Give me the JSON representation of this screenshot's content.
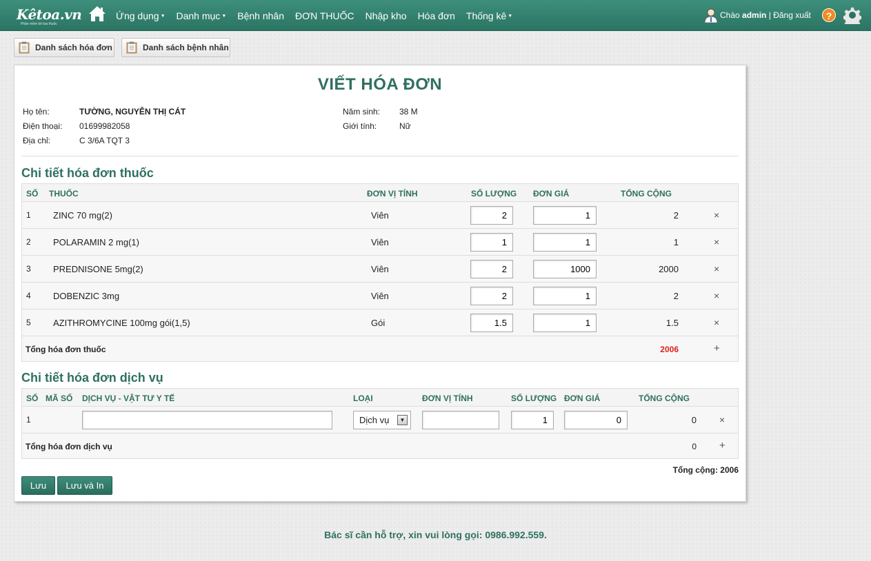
{
  "brand": {
    "logo": "Kêtoa.vn",
    "tagline": "Phần mềm kê toa thuốc"
  },
  "nav": {
    "home_icon": "home-icon",
    "items": [
      {
        "label": "Ứng dụng",
        "dropdown": true
      },
      {
        "label": "Danh mục",
        "dropdown": true
      },
      {
        "label": "Bệnh nhân",
        "dropdown": false
      },
      {
        "label": "ĐƠN THUỐC",
        "dropdown": false
      },
      {
        "label": "Nhập kho",
        "dropdown": false
      },
      {
        "label": "Hóa đơn",
        "dropdown": false
      },
      {
        "label": "Thống kê",
        "dropdown": true
      }
    ],
    "greeting": "Chào",
    "username": "admin",
    "separator": "|",
    "logout": "Đăng xuất"
  },
  "toolbar": {
    "invoice_list": "Danh sách hóa đơn",
    "patient_list": "Danh sách bệnh nhân"
  },
  "page_title": "VIẾT HÓA ĐƠN",
  "patient": {
    "name_label": "Họ tên:",
    "name": "TƯỜNG, NGUYỄN THỊ CÁT",
    "phone_label": "Điện thoại:",
    "phone": "01699982058",
    "address_label": "Địa chỉ:",
    "address": "C 3/6A TQT 3",
    "birth_label": "Năm sinh:",
    "birth": "38 M",
    "gender_label": "Giới tính:",
    "gender": "Nữ"
  },
  "drugs": {
    "section_title": "Chi tiết hóa đơn thuốc",
    "headers": {
      "no": "SỐ",
      "drug": "THUỐC",
      "unit": "ĐƠN VỊ TÍNH",
      "qty": "SỐ LƯỢNG",
      "price": "ĐƠN GIÁ",
      "total": "TỔNG CỘNG"
    },
    "rows": [
      {
        "no": "1",
        "name": "ZINC 70 mg(2)",
        "unit": "Viên",
        "qty": "2",
        "price": "1",
        "total": "2"
      },
      {
        "no": "2",
        "name": "POLARAMIN 2 mg(1)",
        "unit": "Viên",
        "qty": "1",
        "price": "1",
        "total": "1"
      },
      {
        "no": "3",
        "name": "PREDNISONE 5mg(2)",
        "unit": "Viên",
        "qty": "2",
        "price": "1000",
        "total": "2000"
      },
      {
        "no": "4",
        "name": "DOBENZIC 3mg",
        "unit": "Viên",
        "qty": "2",
        "price": "1",
        "total": "2"
      },
      {
        "no": "5",
        "name": "AZITHROMYCINE 100mg gói(1,5)",
        "unit": "Gói",
        "qty": "1.5",
        "price": "1",
        "total": "1.5"
      }
    ],
    "remove_symbol": "×",
    "sum_label": "Tổng hóa đơn thuốc",
    "sum_value": "2006",
    "sum_color": "#e02020",
    "add_symbol": "+"
  },
  "services": {
    "section_title": "Chi tiết hóa đơn dịch vụ",
    "headers": {
      "no": "SỐ",
      "code": "MÃ SỐ",
      "service": "DỊCH VỤ - VẬT TƯ Y TẾ",
      "type": "LOẠI",
      "unit": "ĐƠN VỊ TÍNH",
      "qty": "SỐ LƯỢNG",
      "price": "ĐƠN GIÁ",
      "total": "TỔNG CỘNG"
    },
    "rows": [
      {
        "no": "1",
        "code": "",
        "service": "",
        "type": "Dịch vụ",
        "unit": "",
        "qty": "1",
        "price": "0",
        "total": "0"
      }
    ],
    "remove_symbol": "×",
    "sum_label": "Tổng hóa đơn dịch vụ",
    "sum_value": "0",
    "add_symbol": "+"
  },
  "grand_total": "Tổng cộng: 2006",
  "buttons": {
    "save": "Lưu",
    "save_print": "Lưu và In"
  },
  "footer": "Bác sĩ cần hỗ trợ, xin vui lòng gọi: 0986.992.559.",
  "colors": {
    "brand": "#2f7060",
    "nav_bg": "#3d8f7c",
    "accent_red": "#e02020"
  }
}
